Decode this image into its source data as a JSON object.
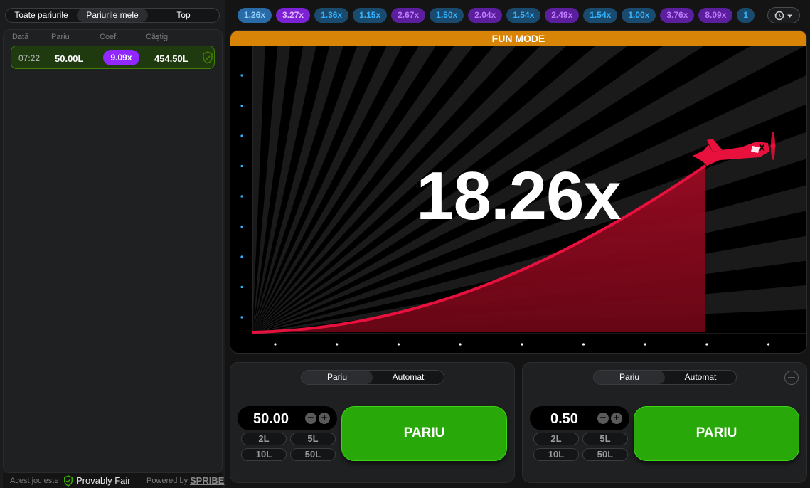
{
  "sidebar": {
    "tabs": [
      "Toate pariurile",
      "Pariurile mele",
      "Top"
    ],
    "active_tab": 1,
    "columns": [
      "Dată",
      "Pariu",
      "Coef.",
      "Câștig"
    ],
    "bets": [
      {
        "time": "07:22",
        "amount": "50.00",
        "currency": "L",
        "coef": "9.09x",
        "win": "454.50"
      }
    ],
    "footer": {
      "text_prefix": "Acest joc este",
      "provably_fair": "Provably Fair",
      "powered_by": "Powered by",
      "brand": "SPRIBE"
    }
  },
  "history": {
    "multipliers": [
      {
        "value": "1.26x",
        "color": "blue"
      },
      {
        "value": "3.27x",
        "color": "purple"
      },
      {
        "value": "1.36x",
        "color": "blue"
      },
      {
        "value": "1.15x",
        "color": "blue"
      },
      {
        "value": "2.67x",
        "color": "purple"
      },
      {
        "value": "1.50x",
        "color": "blue"
      },
      {
        "value": "2.04x",
        "color": "purple"
      },
      {
        "value": "1.54x",
        "color": "blue"
      },
      {
        "value": "2.49x",
        "color": "purple"
      },
      {
        "value": "1.54x",
        "color": "blue"
      },
      {
        "value": "1.00x",
        "color": "blue"
      },
      {
        "value": "3.76x",
        "color": "purple"
      },
      {
        "value": "8.09x",
        "color": "purple"
      },
      {
        "value": "1",
        "color": "blue"
      }
    ],
    "history_button_icons": [
      "history-icon",
      "chevron-down-icon"
    ]
  },
  "game": {
    "mode_banner": "FUN MODE",
    "current_multiplier": "18.26x",
    "colors": {
      "banner": "#d88406",
      "curve": "#e8103c",
      "bet_button": "#28a909",
      "purple": "#9128ff",
      "blue": "#34b4ff"
    }
  },
  "panels": [
    {
      "modes": [
        "Pariu",
        "Automat"
      ],
      "active_mode": 0,
      "stake": "50.00",
      "quick": [
        "2",
        "5",
        "10",
        "50"
      ],
      "currency": "L",
      "button": "PARIU"
    },
    {
      "modes": [
        "Pariu",
        "Automat"
      ],
      "active_mode": 0,
      "stake": "0.50",
      "quick": [
        "2",
        "5",
        "10",
        "50"
      ],
      "currency": "L",
      "button": "PARIU",
      "removable": true
    }
  ]
}
